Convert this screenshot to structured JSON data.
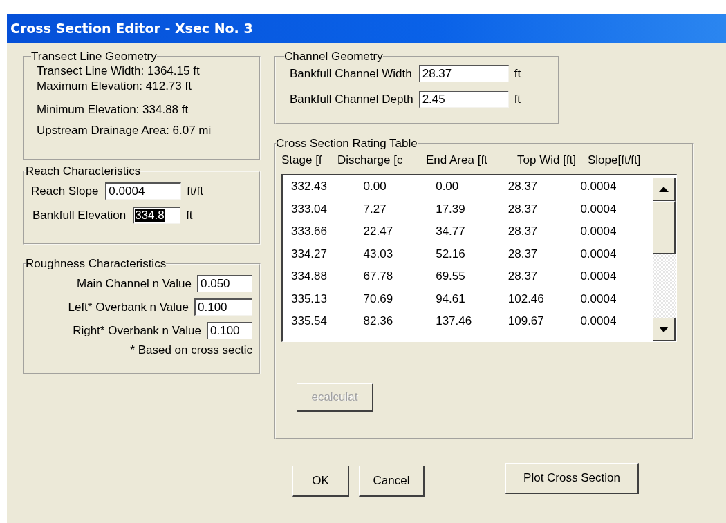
{
  "window": {
    "title": "Cross Section Editor - Xsec No. 3"
  },
  "transect_line_geometry": {
    "title": "Transect Line Geometry",
    "lines": [
      "Transect Line Width: 1364.15 ft",
      "Maximum Elevation: 412.73 ft",
      "Minimum Elevation: 334.88 ft",
      "Upstream Drainage Area: 6.07 mi"
    ]
  },
  "reach_characteristics": {
    "title": "Reach Characteristics",
    "fields": [
      {
        "label": "Reach Slope",
        "value": "0.0004",
        "unit": "ft/ft",
        "highlighted": false
      },
      {
        "label": "Bankfull Elevation",
        "value": "334.8",
        "unit": "ft",
        "highlighted": true
      }
    ]
  },
  "roughness_characteristics": {
    "title": "Roughness Characteristics",
    "fields": [
      {
        "label": "Main Channel n Value",
        "value": "0.050"
      },
      {
        "label": "Left* Overbank n Value",
        "value": "0.100"
      },
      {
        "label": "Right* Overbank n Value",
        "value": "0.100"
      }
    ],
    "note": "* Based on cross sectic"
  },
  "channel_geometry": {
    "title": "Channel Geometry",
    "fields": [
      {
        "label": "Bankfull Channel Width",
        "value": "28.37",
        "unit": "ft"
      },
      {
        "label": "Bankfull Channel Depth",
        "value": "2.45",
        "unit": "ft"
      }
    ]
  },
  "rating_table": {
    "title": "Cross Section Rating Table",
    "columns": [
      "Stage [f",
      "Discharge [c",
      "End Area [ft",
      "Top Wid [ft]",
      "Slope[ft/ft]"
    ],
    "rows": [
      [
        "332.43",
        "0.00",
        "0.00",
        "28.37",
        "0.0004"
      ],
      [
        "333.04",
        "7.27",
        "17.39",
        "28.37",
        "0.0004"
      ],
      [
        "333.66",
        "22.47",
        "34.77",
        "28.37",
        "0.0004"
      ],
      [
        "334.27",
        "43.03",
        "52.16",
        "28.37",
        "0.0004"
      ],
      [
        "334.88",
        "67.78",
        "69.55",
        "28.37",
        "0.0004"
      ],
      [
        "335.13",
        "70.69",
        "94.61",
        "102.46",
        "0.0004"
      ],
      [
        "335.54",
        "82.36",
        "137.46",
        "109.67",
        "0.0004"
      ]
    ],
    "recalculate_button": {
      "label": "ecalculat",
      "disabled": true
    }
  },
  "buttons": [
    {
      "label": "OK"
    },
    {
      "label": "Cancel"
    },
    {
      "label": "Plot Cross Section"
    }
  ]
}
